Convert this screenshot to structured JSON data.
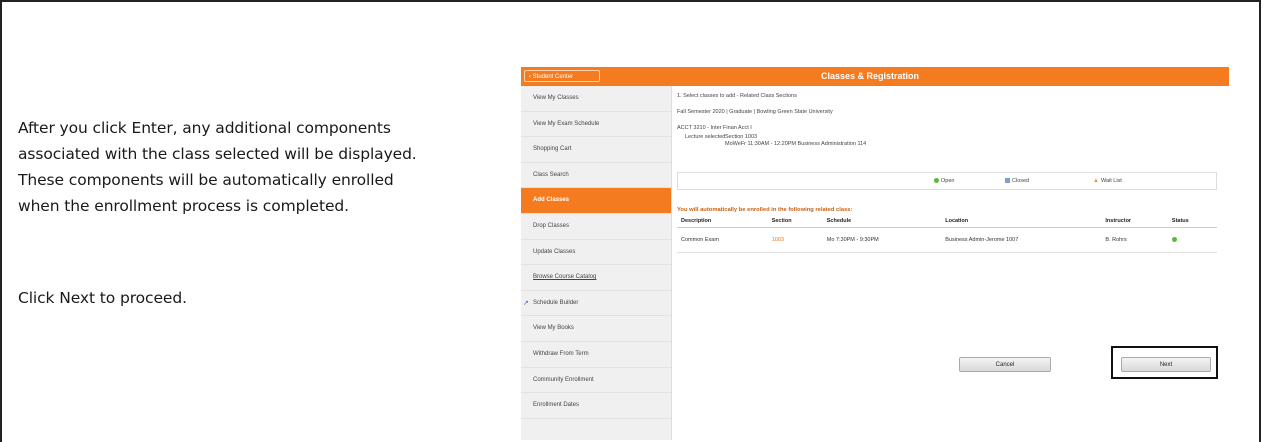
{
  "instructions": {
    "line1": "After you click Enter, any additional components",
    "line2": "associated with the class selected will be displayed.",
    "line3": "These components will be automatically enrolled",
    "line4": "when the enrollment process is completed.",
    "line5": "Click Next to proceed."
  },
  "header": {
    "back_label": "‹ Student Center",
    "title": "Classes & Registration"
  },
  "sidebar": {
    "items": [
      {
        "label": "View My Classes"
      },
      {
        "label": "View My Exam Schedule"
      },
      {
        "label": "Shopping Cart"
      },
      {
        "label": "Class Search"
      },
      {
        "label": "Add Classes"
      },
      {
        "label": "Drop Classes"
      },
      {
        "label": "Update Classes"
      },
      {
        "label": "Browse Course Catalog"
      },
      {
        "label": "Schedule Builder"
      },
      {
        "label": "View My Books"
      },
      {
        "label": "Withdraw From Term"
      },
      {
        "label": "Community Enrollment"
      },
      {
        "label": "Enrollment Dates"
      }
    ]
  },
  "main": {
    "step": "1.  Select classes to add - Related Class Sections",
    "term": "Fall Semester 2020 | Graduate | Bowling Green State University",
    "course": "ACCT 3210 - Inter Finan Acct I",
    "lecture_label": "Lecture selected",
    "lecture_section": "Section 1003",
    "lecture_time": "MoWeFr 11:30AM - 12:20PM   Business Administration 114",
    "legend": {
      "open": "Open",
      "closed": "Closed",
      "wait": "Wait List"
    },
    "auto_msg": "You will automatically be enrolled in the following related class:",
    "table": {
      "headers": [
        "Description",
        "Section",
        "Schedule",
        "Location",
        "Instructor",
        "Status"
      ],
      "rows": [
        {
          "description": "Common Exam",
          "section": "1003",
          "schedule": "Mo 7:30PM - 9:30PM",
          "location": "Business Admin-Jerome 1007",
          "instructor": "B. Rohrs",
          "status": "open"
        }
      ]
    },
    "cancel_label": "Cancel",
    "next_label": "Next"
  },
  "colors": {
    "accent": "#f47b20",
    "open": "#5cb83a",
    "closed": "#7a9fd9",
    "wait": "#e6a000"
  }
}
